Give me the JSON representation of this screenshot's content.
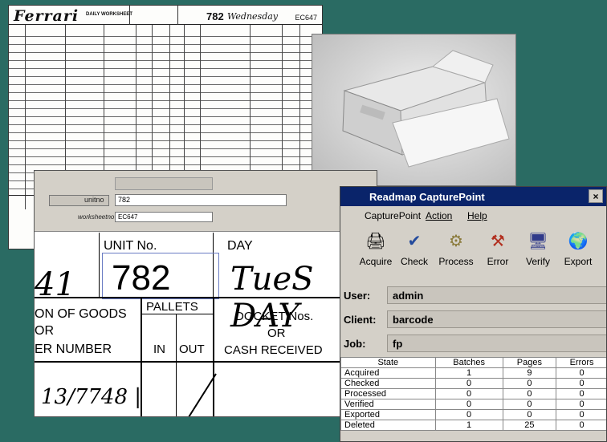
{
  "worksheet": {
    "brand": "Ferrari",
    "daily_label": "DAILY WORKSHEET",
    "unit_no": "782",
    "day_hand": "Wednesday",
    "worksheet_no": "EC647"
  },
  "unit_window": {
    "unitno_label": "unitno",
    "unitno_value": "782",
    "worksheetno_label": "worksheetno",
    "worksheetno_value": "EC647",
    "crop": {
      "unit_no_header": "UNIT No.",
      "unit_no_value": "782",
      "day_header": "DAY",
      "goods_line1": "ON OF GOODS",
      "goods_line2": "OR",
      "goods_line3": "ER NUMBER",
      "pallets": "PALLETS",
      "in": "IN",
      "out": "OUT",
      "docket1": "DOCKET Nos.",
      "docket2": "OR",
      "docket3": "CASH RECEIVED"
    }
  },
  "capture": {
    "title": "Readmap CapturePoint",
    "close": "×",
    "menu": [
      "CapturePoint",
      "Action",
      "Help"
    ],
    "tools": [
      {
        "label": "Acquire",
        "icon": "scanner-icon"
      },
      {
        "label": "Check",
        "icon": "check-icon"
      },
      {
        "label": "Process",
        "icon": "gears-icon"
      },
      {
        "label": "Error",
        "icon": "tools-icon"
      },
      {
        "label": "Verify",
        "icon": "computer-icon"
      },
      {
        "label": "Export",
        "icon": "globe-icon"
      }
    ],
    "fields": [
      {
        "key": "User:",
        "value": "admin"
      },
      {
        "key": "Client:",
        "value": "barcode"
      },
      {
        "key": "Job:",
        "value": "fp"
      }
    ],
    "table": {
      "headers": [
        "State",
        "Batches",
        "Pages",
        "Errors"
      ],
      "rows": [
        [
          "Acquired",
          "1",
          "9",
          "0"
        ],
        [
          "Checked",
          "0",
          "0",
          "0"
        ],
        [
          "Processed",
          "0",
          "0",
          "0"
        ],
        [
          "Verified",
          "0",
          "0",
          "0"
        ],
        [
          "Exported",
          "0",
          "0",
          "0"
        ],
        [
          "Deleted",
          "1",
          "25",
          "0"
        ]
      ]
    }
  }
}
